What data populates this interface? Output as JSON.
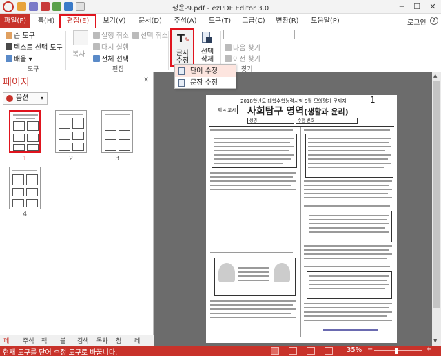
{
  "window": {
    "title": "생윤-9.pdf - ezPDF Editor 3.0",
    "minimize": "─",
    "maximize": "☐",
    "close": "✕"
  },
  "menu": {
    "tabs": [
      "파일(F)",
      "홈(H)",
      "편집(E)",
      "보기(V)",
      "문서(D)",
      "주석(A)",
      "도구(T)",
      "고급(C)",
      "변환(R)",
      "도움말(P)"
    ],
    "active": "편집(E)",
    "login": "로그인",
    "help": "?"
  },
  "ribbon": {
    "tool_group": {
      "hand": "손 도구",
      "text_select": "텍스트 선택 도구",
      "layout": "배율",
      "label": "도구"
    },
    "edit_group": {
      "copy": "복사",
      "undo": "실행 취소",
      "redo": "다시 실행",
      "select_all": "전체 선택",
      "select_cancel": "선택 취소",
      "label": "편집"
    },
    "letter_edit": {
      "label_line1": "글자",
      "label_line2": "수정"
    },
    "select_delete": {
      "label_line1": "선택",
      "label_line2": "삭제"
    },
    "find_group": {
      "next": "다음 찾기",
      "prev": "이전 찾기",
      "label": "찾기"
    },
    "dropdown": {
      "item1": "단어 수정",
      "item2": "문장 수정"
    }
  },
  "left_panel": {
    "title": "페이지",
    "close": "✕",
    "options": "옵션",
    "thumbnails": [
      "1",
      "2",
      "3",
      "4"
    ],
    "tabs": [
      "페",
      "주석",
      "책",
      "블",
      "검색",
      "목차",
      "첨",
      "레"
    ]
  },
  "document": {
    "page_number": "1",
    "exam_title": "2018학년도 대학수학능력시험 9월 모의평가 문제지",
    "period_box": "제 4 교시",
    "subject": "사회탐구 영역",
    "subject_sub": "(생활과 윤리)",
    "name_label": "성명",
    "id_label": "수험 번호"
  },
  "status": {
    "message": "현재 도구를 단어 수정 도구로 바꿉니다.",
    "zoom": "35%",
    "minus": "−",
    "plus": "+"
  },
  "colors": {
    "accent": "#c8322a",
    "highlight_box": "#e0141e"
  }
}
